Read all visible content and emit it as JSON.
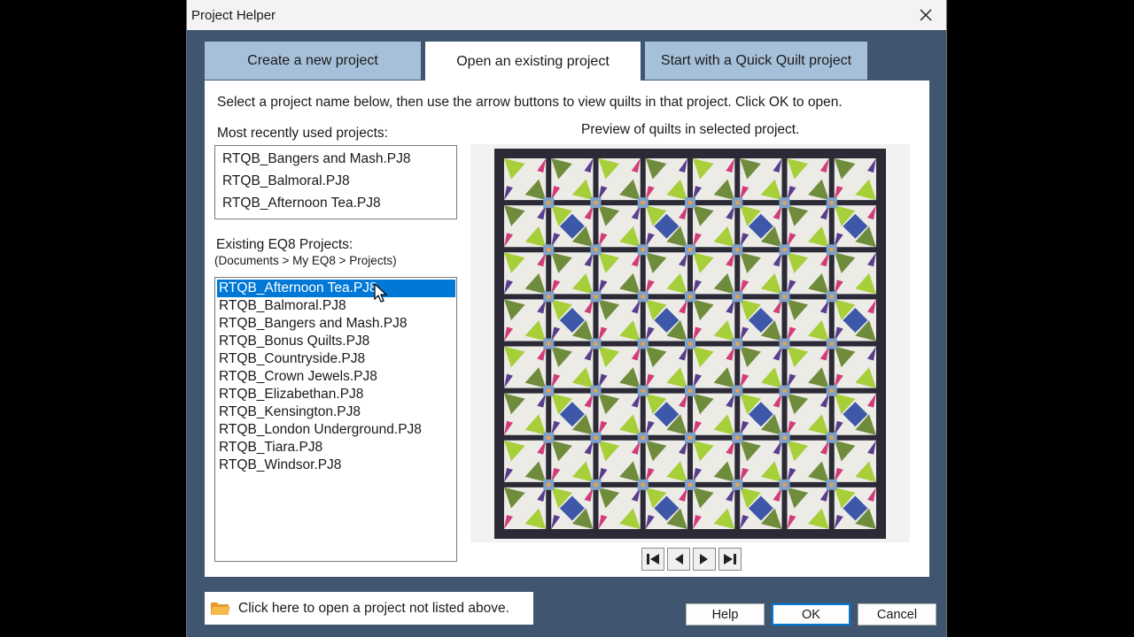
{
  "window": {
    "title": "Project Helper"
  },
  "tabs": [
    {
      "label": "Create a new project"
    },
    {
      "label": "Open an existing project"
    },
    {
      "label": "Start with a Quick Quilt project"
    }
  ],
  "instructions": "Select a project name below, then use the arrow buttons to view quilts in that project. Click OK to open.",
  "recent": {
    "label": "Most recently used projects:",
    "items": [
      "RTQB_Bangers and Mash.PJ8",
      "RTQB_Balmoral.PJ8",
      "RTQB_Afternoon Tea.PJ8"
    ]
  },
  "existing": {
    "label": "Existing EQ8 Projects:",
    "path": "(Documents > My EQ8 > Projects)",
    "items": [
      "RTQB_Afternoon Tea.PJ8",
      "RTQB_Balmoral.PJ8",
      "RTQB_Bangers and Mash.PJ8",
      "RTQB_Bonus Quilts.PJ8",
      "RTQB_Countryside.PJ8",
      "RTQB_Crown Jewels.PJ8",
      "RTQB_Elizabethan.PJ8",
      "RTQB_Kensington.PJ8",
      "RTQB_London Underground.PJ8",
      "RTQB_Tiara.PJ8",
      "RTQB_Windsor.PJ8"
    ],
    "selected_index": 0
  },
  "preview": {
    "label": "Preview of quilts in selected project."
  },
  "open_other": {
    "label": "Click here to open a project not listed above.",
    "icon": "folder-icon"
  },
  "buttons": {
    "help": "Help",
    "ok": "OK",
    "cancel": "Cancel"
  },
  "colors": {
    "frame": "#3f5570",
    "tab_inactive": "#a7c0d9",
    "selection": "#0078d7",
    "quilt_border": "#2b2a36",
    "quilt_lime": "#a6cf3a",
    "quilt_blue": "#3d58a8",
    "quilt_green": "#6f8c3d",
    "quilt_purple": "#5a3d8f",
    "quilt_pink": "#d13b7a"
  }
}
